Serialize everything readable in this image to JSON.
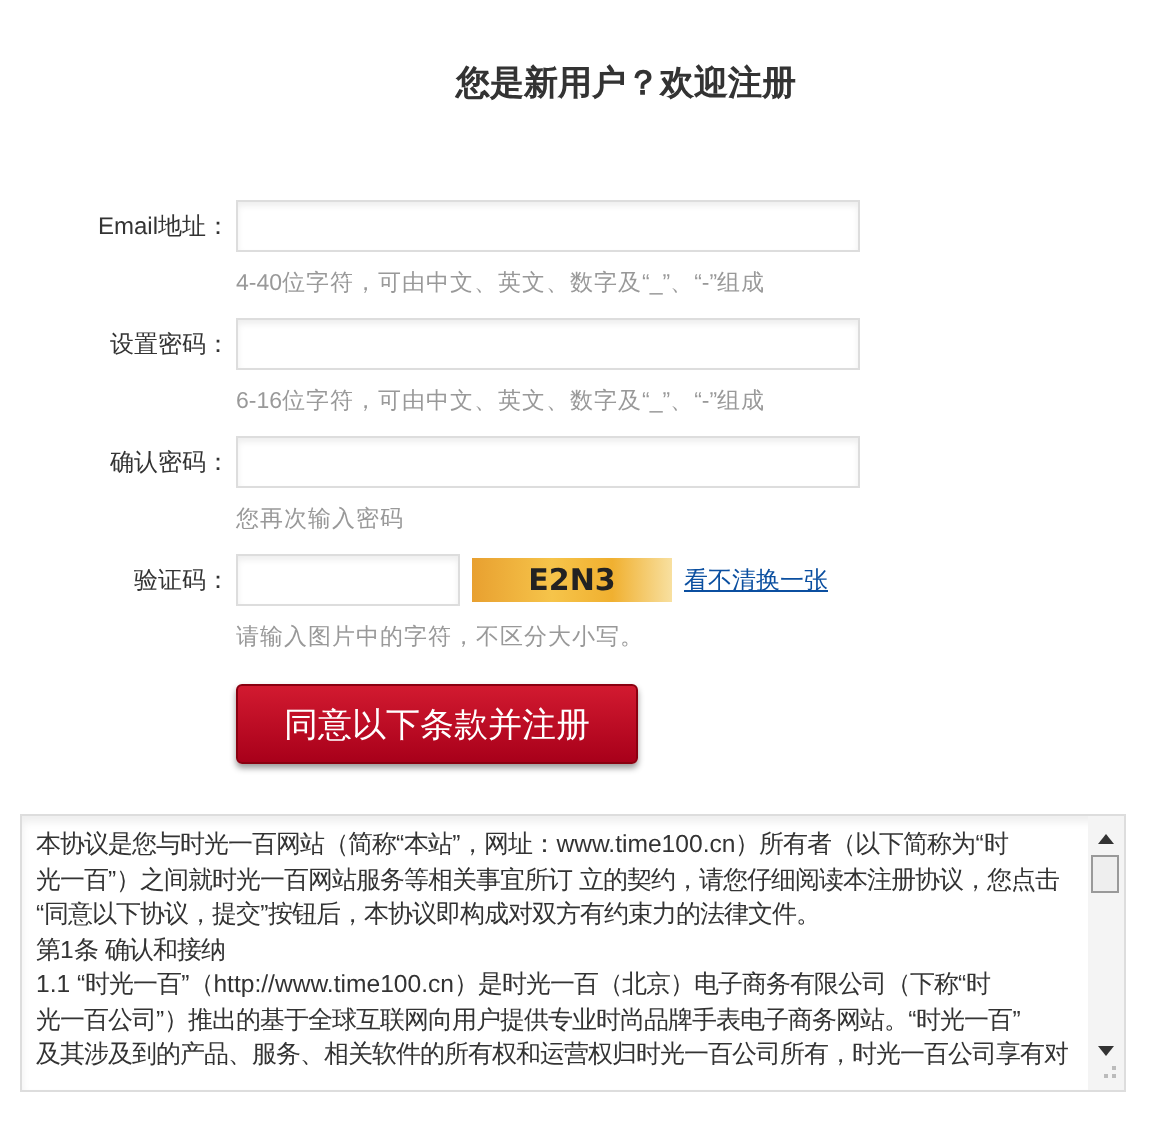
{
  "title": "您是新用户？欢迎注册",
  "fields": [
    {
      "kind": "text",
      "label": "Email地址：",
      "hint": "4-40位字符，可由中文、英文、数字及“_”、“-”组成"
    },
    {
      "kind": "text",
      "label": "设置密码：",
      "hint": "6-16位字符，可由中文、英文、数字及“_”、“-”组成"
    },
    {
      "kind": "text",
      "label": "确认密码：",
      "hint": "您再次输入密码"
    },
    {
      "kind": "captcha",
      "label": "验证码：",
      "captcha": "E2N3",
      "refresh_link": "看不清换一张",
      "hint": "请输入图片中的字符，不区分大小写。"
    }
  ],
  "submit_button": "同意以下条款并注册",
  "agreement_lines": [
    "本协议是您与时光一百网站（简称“本站”，网址：www.time100.cn）所有者（以下简称为“时",
    "光一百”）之间就时光一百网站服务等相关事宜所订 立的契约，请您仔细阅读本注册协议，您点击",
    "“同意以下协议，提交”按钮后，本协议即构成对双方有约束力的法律文件。",
    "第1条 确认和接纳",
    "1.1 “时光一百”（http://www.time100.cn）是时光一百（北京）电子商务有限公司（下称“时",
    "光一百公司”）推出的基于全球互联网向用户提供专业时尚品牌手表电子商务网站。“时光一百”",
    "及其涉及到的产品、服务、相关软件的所有权和运营权归时光一百公司所有，时光一百公司享有对"
  ]
}
